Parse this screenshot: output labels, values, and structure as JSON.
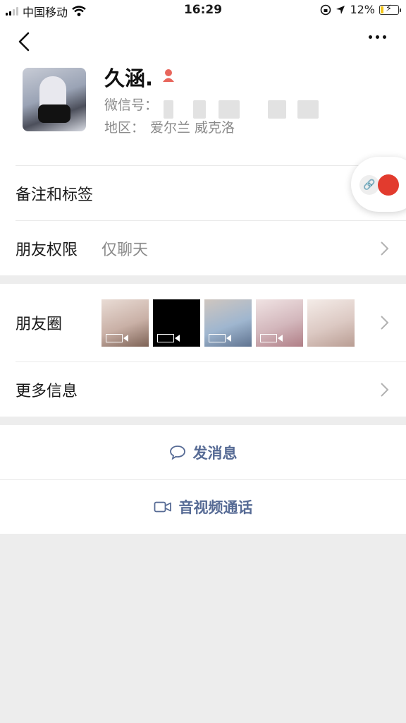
{
  "status_bar": {
    "carrier": "中国移动",
    "time": "16:29",
    "battery": "12%"
  },
  "profile": {
    "name": "久涵.",
    "wechat_id_label": "微信号：",
    "region_label": "地区：",
    "region_value": "爱尔兰 威克洛"
  },
  "rows": {
    "remarks": {
      "label": "备注和标签"
    },
    "permissions": {
      "label": "朋友权限",
      "value": "仅聊天"
    },
    "moments": {
      "label": "朋友圈"
    },
    "more_info": {
      "label": "更多信息"
    }
  },
  "moments_thumbs": [
    {
      "kind": "video",
      "palette": "#d8c8c0"
    },
    {
      "kind": "video",
      "palette": "#000000"
    },
    {
      "kind": "video",
      "palette": "#8aa8c8"
    },
    {
      "kind": "video",
      "palette": "#dcc8cc"
    },
    {
      "kind": "photo",
      "palette": "#e6dad6"
    }
  ],
  "actions": {
    "message": "发消息",
    "call": "音视频通话"
  },
  "colors": {
    "accent": "#576b95",
    "gender_icon": "#e8665c"
  }
}
